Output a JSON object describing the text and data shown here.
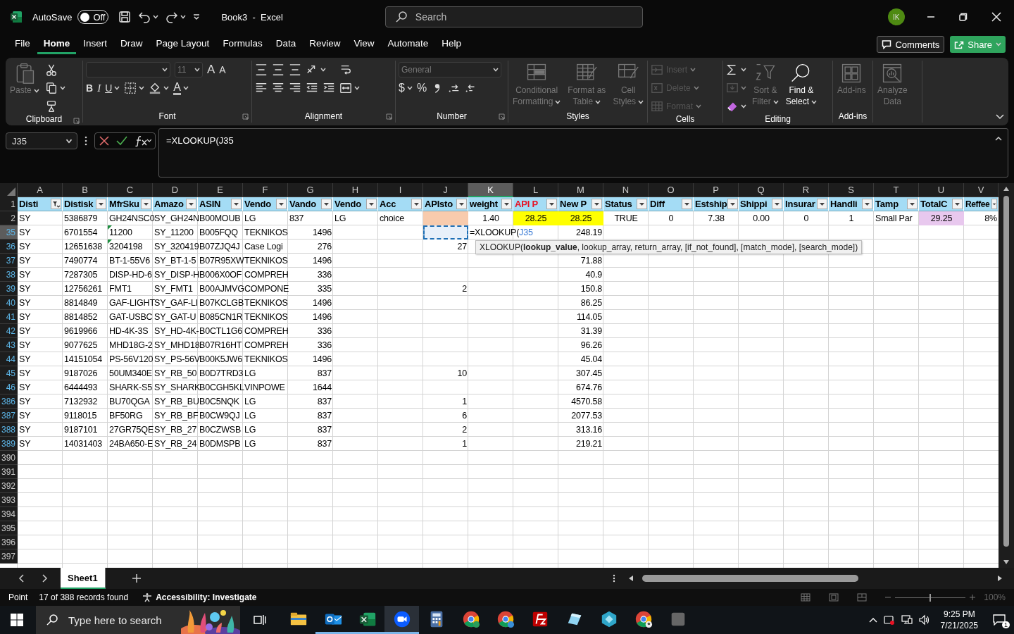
{
  "title_bar": {
    "autosave_label": "AutoSave",
    "autosave": {
      "on": false,
      "label": "Off"
    },
    "title": "Book3  -  Excel",
    "search_placeholder": "Search",
    "avatar": "IK"
  },
  "menu_tabs": [
    {
      "label": "File",
      "selected": false
    },
    {
      "label": "Home",
      "selected": true
    },
    {
      "label": "Insert",
      "selected": false
    },
    {
      "label": "Draw",
      "selected": false
    },
    {
      "label": "Page Layout",
      "selected": false
    },
    {
      "label": "Formulas",
      "selected": false
    },
    {
      "label": "Data",
      "selected": false
    },
    {
      "label": "Review",
      "selected": false
    },
    {
      "label": "View",
      "selected": false
    },
    {
      "label": "Automate",
      "selected": false
    },
    {
      "label": "Help",
      "selected": false
    }
  ],
  "comments_button": "Comments",
  "share_button": "Share",
  "ribbon": {
    "groups": [
      {
        "label": "Clipboard",
        "launcher": true,
        "sections": [
          {
            "kind": "large",
            "label": "Paste",
            "disabled": true,
            "menu": true
          },
          {
            "kind": "rows",
            "rows": [
              [
                {
                  "kind": "icon",
                  "disabled": false
                }
              ],
              [
                {
                  "kind": "icon",
                  "disabled": false,
                  "menu": true
                }
              ],
              [
                {
                  "kind": "icon",
                  "disabled": false
                }
              ]
            ]
          }
        ]
      },
      {
        "label": "Font",
        "launcher": true,
        "sections": [
          {
            "kind": "rows",
            "rows": [
              [
                {
                  "kind": "field",
                  "disabled": true,
                  "menu": true
                },
                {
                  "kind": "field",
                  "value": "11",
                  "disabled": true,
                  "menu": true
                },
                {
                  "kind": "glyph",
                  "text": "A",
                  "disabled": false
                },
                {
                  "kind": "glyph",
                  "text": "A",
                  "disabled": false
                }
              ],
              [
                {
                  "kind": "glyph",
                  "text": "B",
                  "disabled": false
                },
                {
                  "kind": "glyph",
                  "text": "I",
                  "disabled": false
                },
                {
                  "kind": "glyph",
                  "text": "U",
                  "disabled": false,
                  "menu": true
                },
                {
                  "kind": "icon",
                  "disabled": false,
                  "menu": true
                },
                {
                  "kind": "icon",
                  "disabled": false,
                  "menu": true
                },
                {
                  "kind": "glyph",
                  "text": "A",
                  "disabled": false,
                  "menu": true
                }
              ]
            ]
          }
        ]
      },
      {
        "label": "Alignment",
        "launcher": true,
        "sections": [
          {
            "kind": "rows",
            "rows": [
              [
                {
                  "kind": "icon",
                  "disabled": false
                },
                {
                  "kind": "icon",
                  "disabled": false
                },
                {
                  "kind": "icon",
                  "disabled": false
                },
                {
                  "kind": "icon",
                  "disabled": false,
                  "menu": true
                }
              ],
              [
                {
                  "kind": "icon",
                  "disabled": false
                },
                {
                  "kind": "icon",
                  "disabled": false
                },
                {
                  "kind": "icon",
                  "disabled": false
                },
                {
                  "kind": "icon",
                  "disabled": false
                },
                {
                  "kind": "icon",
                  "disabled": false
                }
              ]
            ]
          },
          {
            "kind": "rows",
            "rows": [
              [
                {
                  "kind": "icon",
                  "disabled": false
                }
              ],
              [
                {
                  "kind": "icon",
                  "disabled": false,
                  "menu": true
                }
              ]
            ]
          }
        ]
      },
      {
        "label": "Number",
        "launcher": true,
        "sections": [
          {
            "kind": "rows",
            "rows": [
              [
                {
                  "kind": "field",
                  "value": "General",
                  "disabled": true,
                  "menu": true
                }
              ],
              [
                {
                  "kind": "glyph",
                  "text": "$",
                  "disabled": false,
                  "menu": true
                },
                {
                  "kind": "glyph",
                  "text": "%",
                  "disabled": false
                },
                {
                  "kind": "icon",
                  "disabled": false
                },
                {
                  "kind": "icon",
                  "disabled": false
                },
                {
                  "kind": "icon",
                  "disabled": false
                }
              ]
            ]
          }
        ]
      },
      {
        "label": "Styles",
        "sections": [
          {
            "kind": "large",
            "label": "Conditional\nFormatting",
            "disabled": true,
            "menu": true
          },
          {
            "kind": "large",
            "label": "Format as\nTable",
            "disabled": true,
            "menu": true
          },
          {
            "kind": "large",
            "label": "Cell\nStyles",
            "disabled": true,
            "menu": true
          }
        ]
      },
      {
        "label": "Cells",
        "sections": [
          {
            "kind": "rows",
            "rows": [
              [
                {
                  "kind": "labeled",
                  "label": "Insert",
                  "disabled": true,
                  "menu": true
                }
              ],
              [
                {
                  "kind": "labeled",
                  "label": "Delete",
                  "disabled": true,
                  "menu": true
                }
              ],
              [
                {
                  "kind": "labeled",
                  "label": "Format",
                  "disabled": true,
                  "menu": true
                }
              ]
            ]
          }
        ]
      },
      {
        "label": "Editing",
        "sections": [
          {
            "kind": "rows",
            "rows": [
              [
                {
                  "kind": "icon",
                  "disabled": false,
                  "menu": true
                }
              ],
              [
                {
                  "kind": "icon",
                  "disabled": true,
                  "menu": true
                }
              ],
              [
                {
                  "kind": "icon",
                  "disabled": false,
                  "menu": true
                }
              ]
            ]
          },
          {
            "kind": "large",
            "label": "Sort &\nFilter",
            "disabled": true,
            "menu": true
          },
          {
            "kind": "large",
            "label": "Find &\nSelect",
            "disabled": false,
            "menu": true
          }
        ]
      },
      {
        "label": "Add-ins",
        "sections": [
          {
            "kind": "large",
            "label": "Add-ins",
            "disabled": true
          }
        ]
      },
      {
        "sections": [
          {
            "kind": "large",
            "label": "Analyze\nData",
            "disabled": true
          }
        ]
      }
    ]
  },
  "formula_bar": {
    "name_box": "J35",
    "formula": "=XLOOKUP(J35"
  },
  "sheet": {
    "columns": [
      {
        "letter": "A",
        "selected": false
      },
      {
        "letter": "B",
        "selected": false
      },
      {
        "letter": "C",
        "selected": false
      },
      {
        "letter": "D",
        "selected": false
      },
      {
        "letter": "E",
        "selected": false
      },
      {
        "letter": "F",
        "selected": false
      },
      {
        "letter": "G",
        "selected": false
      },
      {
        "letter": "H",
        "selected": false
      },
      {
        "letter": "I",
        "selected": false
      },
      {
        "letter": "J",
        "selected": false
      },
      {
        "letter": "K",
        "selected": true
      },
      {
        "letter": "L",
        "selected": false
      },
      {
        "letter": "M",
        "selected": false
      },
      {
        "letter": "N",
        "selected": false
      },
      {
        "letter": "O",
        "selected": false
      },
      {
        "letter": "P",
        "selected": false
      },
      {
        "letter": "Q",
        "selected": false
      },
      {
        "letter": "R",
        "selected": false
      },
      {
        "letter": "S",
        "selected": false
      },
      {
        "letter": "T",
        "selected": false
      },
      {
        "letter": "U",
        "selected": false
      },
      {
        "letter": "V",
        "selected": false
      }
    ],
    "rows": [
      {
        "number": "1",
        "kind": "header",
        "filtered": false,
        "selected": false,
        "cells": [
          {
            "text": "Disti",
            "filter_applied": true
          },
          {
            "text": "Distisk",
            "filter_applied": false
          },
          {
            "text": "MfrSku",
            "filter_applied": false
          },
          {
            "text": "Amazo",
            "filter_applied": false
          },
          {
            "text": "ASIN",
            "filter_applied": false
          },
          {
            "text": "Vendo",
            "filter_applied": false
          },
          {
            "text": "Vando",
            "filter_applied": false
          },
          {
            "text": "Vendo",
            "filter_applied": false
          },
          {
            "text": "Acc",
            "filter_applied": false
          },
          {
            "text": "APIsto",
            "filter_applied": false
          },
          {
            "text": "weight",
            "filter_applied": false
          },
          {
            "text": "API P",
            "color": "#e81123",
            "filter_applied": false
          },
          {
            "text": "New P",
            "filter_applied": false
          },
          {
            "text": "Status",
            "filter_applied": false
          },
          {
            "text": "Diff",
            "filter_applied": false
          },
          {
            "text": "Estship",
            "filter_applied": false
          },
          {
            "text": "Shippi",
            "filter_applied": false
          },
          {
            "text": "Insurar",
            "filter_applied": false
          },
          {
            "text": "Handli",
            "filter_applied": false
          },
          {
            "text": "Tamp",
            "filter_applied": false
          },
          {
            "text": "TotalC",
            "filter_applied": false
          },
          {
            "text": "Reffee",
            "filter_applied": false
          }
        ]
      },
      {
        "number": "2",
        "kind": "data",
        "filtered": false,
        "selected": false,
        "cells": [
          {
            "text": "SY"
          },
          {
            "text": "5386879"
          },
          {
            "text": "GH24NSC0"
          },
          {
            "text": "SY_GH24N"
          },
          {
            "text": "B00MOUB"
          },
          {
            "text": "LG"
          },
          {
            "text": "837"
          },
          {
            "text": "LG"
          },
          {
            "text": "choice"
          },
          {
            "color": "#f8cbad"
          },
          {
            "text": "1.40",
            "kind": "centered"
          },
          {
            "text": "28.25",
            "kind": "centered",
            "color": "#ffff00"
          },
          {
            "text": "28.25",
            "kind": "centered",
            "color": "#ffff00"
          },
          {
            "text": "TRUE",
            "kind": "centered"
          },
          {
            "text": "0",
            "kind": "centered"
          },
          {
            "text": "7.38",
            "kind": "centered"
          },
          {
            "text": "0.00",
            "kind": "centered"
          },
          {
            "text": "0",
            "kind": "centered"
          },
          {
            "text": "1",
            "kind": "centered"
          },
          {
            "text": "Small Par"
          },
          {
            "text": "29.25",
            "kind": "centered",
            "color": "#e8c8ee"
          },
          {
            "text": "8%",
            "kind": "numeric"
          }
        ]
      },
      {
        "number": "35",
        "kind": "data",
        "filtered": true,
        "selected": true,
        "cells": [
          {
            "text": "SY"
          },
          {
            "text": "6701554"
          },
          {
            "text": "11200",
            "error_mark": true
          },
          {
            "text": "SY_11200"
          },
          {
            "text": "B005FQQ"
          },
          {
            "text": "TEKNIKOS"
          },
          {
            "text": "1496",
            "kind": "numeric"
          },
          null,
          null,
          {
            "referenced": true
          },
          {
            "text": "=XLOOKUP(",
            "reference": "J35"
          },
          null,
          {
            "text": "248.19",
            "kind": "numeric"
          }
        ]
      },
      {
        "number": "36",
        "kind": "data",
        "filtered": true,
        "selected": false,
        "cells": [
          {
            "text": "SY"
          },
          {
            "text": "12651638"
          },
          {
            "text": "3204198",
            "error_mark": true
          },
          {
            "text": "SY_320419"
          },
          {
            "text": "B07ZJQ4J"
          },
          {
            "text": "Case Logi"
          },
          {
            "text": "276",
            "kind": "numeric"
          },
          null,
          null,
          {
            "text": "27",
            "kind": "numeric"
          }
        ]
      },
      {
        "number": "37",
        "kind": "data",
        "filtered": true,
        "selected": false,
        "cells": [
          {
            "text": "SY"
          },
          {
            "text": "7490774"
          },
          {
            "text": "BT-1-55V6"
          },
          {
            "text": "SY_BT-1-5"
          },
          {
            "text": "B07R95XW"
          },
          {
            "text": "TEKNIKOS"
          },
          {
            "text": "1496",
            "kind": "numeric"
          },
          null,
          null,
          null,
          null,
          null,
          {
            "text": "71.88",
            "kind": "numeric"
          }
        ]
      },
      {
        "number": "38",
        "kind": "data",
        "filtered": true,
        "selected": false,
        "cells": [
          {
            "text": "SY"
          },
          {
            "text": "7287305"
          },
          {
            "text": "DISP-HD-6"
          },
          {
            "text": "SY_DISP-H"
          },
          {
            "text": "B006X0OF"
          },
          {
            "text": "COMPREH"
          },
          {
            "text": "336",
            "kind": "numeric"
          },
          null,
          null,
          null,
          null,
          null,
          {
            "text": "40.9",
            "kind": "numeric"
          }
        ]
      },
      {
        "number": "39",
        "kind": "data",
        "filtered": true,
        "selected": false,
        "cells": [
          {
            "text": "SY"
          },
          {
            "text": "12756261"
          },
          {
            "text": "FMT1"
          },
          {
            "text": "SY_FMT1"
          },
          {
            "text": "B00AJMVG"
          },
          {
            "text": "COMPONE"
          },
          {
            "text": "335",
            "kind": "numeric"
          },
          null,
          null,
          {
            "text": "2",
            "kind": "numeric"
          },
          null,
          null,
          {
            "text": "150.8",
            "kind": "numeric"
          }
        ]
      },
      {
        "number": "40",
        "kind": "data",
        "filtered": true,
        "selected": false,
        "cells": [
          {
            "text": "SY"
          },
          {
            "text": "8814849"
          },
          {
            "text": "GAF-LIGHT"
          },
          {
            "text": "SY_GAF-LI"
          },
          {
            "text": "B07KCLGB"
          },
          {
            "text": "TEKNIKOS"
          },
          {
            "text": "1496",
            "kind": "numeric"
          },
          null,
          null,
          null,
          null,
          null,
          {
            "text": "86.25",
            "kind": "numeric"
          }
        ]
      },
      {
        "number": "41",
        "kind": "data",
        "filtered": true,
        "selected": false,
        "cells": [
          {
            "text": "SY"
          },
          {
            "text": "8814852"
          },
          {
            "text": "GAT-USBC"
          },
          {
            "text": "SY_GAT-U"
          },
          {
            "text": "B085CN1R"
          },
          {
            "text": "TEKNIKOS"
          },
          {
            "text": "1496",
            "kind": "numeric"
          },
          null,
          null,
          null,
          null,
          null,
          {
            "text": "114.05",
            "kind": "numeric"
          }
        ]
      },
      {
        "number": "42",
        "kind": "data",
        "filtered": true,
        "selected": false,
        "cells": [
          {
            "text": "SY"
          },
          {
            "text": "9619966"
          },
          {
            "text": "HD-4K-3S"
          },
          {
            "text": "SY_HD-4K-"
          },
          {
            "text": "B0CTL1G6"
          },
          {
            "text": "COMPREH"
          },
          {
            "text": "336",
            "kind": "numeric"
          },
          null,
          null,
          null,
          null,
          null,
          {
            "text": "31.39",
            "kind": "numeric"
          }
        ]
      },
      {
        "number": "43",
        "kind": "data",
        "filtered": true,
        "selected": false,
        "cells": [
          {
            "text": "SY"
          },
          {
            "text": "9077625"
          },
          {
            "text": "MHD18G-2"
          },
          {
            "text": "SY_MHD18"
          },
          {
            "text": "B07R16HT"
          },
          {
            "text": "COMPREH"
          },
          {
            "text": "336",
            "kind": "numeric"
          },
          null,
          null,
          null,
          null,
          null,
          {
            "text": "96.26",
            "kind": "numeric"
          }
        ]
      },
      {
        "number": "44",
        "kind": "data",
        "filtered": true,
        "selected": false,
        "cells": [
          {
            "text": "SY"
          },
          {
            "text": "14151054"
          },
          {
            "text": "PS-56V120"
          },
          {
            "text": "SY_PS-56V"
          },
          {
            "text": "B00K5JW6"
          },
          {
            "text": "TEKNIKOS"
          },
          {
            "text": "1496",
            "kind": "numeric"
          },
          null,
          null,
          null,
          null,
          null,
          {
            "text": "45.04",
            "kind": "numeric"
          }
        ]
      },
      {
        "number": "45",
        "kind": "data",
        "filtered": true,
        "selected": false,
        "cells": [
          {
            "text": "SY"
          },
          {
            "text": "9187026"
          },
          {
            "text": "50UM340E"
          },
          {
            "text": "SY_RB_50"
          },
          {
            "text": "B0D7TRD3"
          },
          {
            "text": "LG"
          },
          {
            "text": "837",
            "kind": "numeric"
          },
          null,
          null,
          {
            "text": "10",
            "kind": "numeric"
          },
          null,
          null,
          {
            "text": "307.45",
            "kind": "numeric"
          }
        ]
      },
      {
        "number": "46",
        "kind": "data",
        "filtered": true,
        "selected": false,
        "cells": [
          {
            "text": "SY"
          },
          {
            "text": "6444493"
          },
          {
            "text": "SHARK-S5"
          },
          {
            "text": "SY_SHARK"
          },
          {
            "text": "B0CGH5KL"
          },
          {
            "text": "VINPOWE"
          },
          {
            "text": "1644",
            "kind": "numeric"
          },
          null,
          null,
          null,
          null,
          null,
          {
            "text": "674.76",
            "kind": "numeric"
          }
        ]
      },
      {
        "number": "386",
        "kind": "data",
        "filtered": true,
        "selected": false,
        "cells": [
          {
            "text": "SY"
          },
          {
            "text": "7132932"
          },
          {
            "text": "BU70QGA"
          },
          {
            "text": "SY_RB_BU"
          },
          {
            "text": "B0C5NQK"
          },
          {
            "text": "LG"
          },
          {
            "text": "837",
            "kind": "numeric"
          },
          null,
          null,
          {
            "text": "1",
            "kind": "numeric"
          },
          null,
          null,
          {
            "text": "4570.58",
            "kind": "numeric"
          }
        ]
      },
      {
        "number": "387",
        "kind": "data",
        "filtered": true,
        "selected": false,
        "cells": [
          {
            "text": "SY"
          },
          {
            "text": "9118015"
          },
          {
            "text": "BF50RG"
          },
          {
            "text": "SY_RB_BF"
          },
          {
            "text": "B0CW9QJ"
          },
          {
            "text": "LG"
          },
          {
            "text": "837",
            "kind": "numeric"
          },
          null,
          null,
          {
            "text": "6",
            "kind": "numeric"
          },
          null,
          null,
          {
            "text": "2077.53",
            "kind": "numeric"
          }
        ]
      },
      {
        "number": "388",
        "kind": "data",
        "filtered": true,
        "selected": false,
        "cells": [
          {
            "text": "SY"
          },
          {
            "text": "9187101"
          },
          {
            "text": "27GR75QE"
          },
          {
            "text": "SY_RB_27"
          },
          {
            "text": "B0CZWSB"
          },
          {
            "text": "LG"
          },
          {
            "text": "837",
            "kind": "numeric"
          },
          null,
          null,
          {
            "text": "2",
            "kind": "numeric"
          },
          null,
          null,
          {
            "text": "313.16",
            "kind": "numeric"
          }
        ]
      },
      {
        "number": "389",
        "kind": "data",
        "filtered": true,
        "selected": false,
        "cells": [
          {
            "text": "SY"
          },
          {
            "text": "14031403"
          },
          {
            "text": "24BA650-E"
          },
          {
            "text": "SY_RB_24"
          },
          {
            "text": "B0DMSPB"
          },
          {
            "text": "LG"
          },
          {
            "text": "837",
            "kind": "numeric"
          },
          null,
          null,
          {
            "text": "1",
            "kind": "numeric"
          },
          null,
          null,
          {
            "text": "219.21",
            "kind": "numeric"
          }
        ]
      },
      {
        "number": "390",
        "kind": "data",
        "filtered": false,
        "selected": false
      },
      {
        "number": "391",
        "kind": "data",
        "filtered": false,
        "selected": false
      },
      {
        "number": "392",
        "kind": "data",
        "filtered": false,
        "selected": false
      },
      {
        "number": "393",
        "kind": "data",
        "filtered": false,
        "selected": false
      },
      {
        "number": "394",
        "kind": "data",
        "filtered": false,
        "selected": false
      },
      {
        "number": "395",
        "kind": "data",
        "filtered": false,
        "selected": false
      },
      {
        "number": "396",
        "kind": "data",
        "filtered": false,
        "selected": false
      },
      {
        "number": "397",
        "kind": "data",
        "filtered": false,
        "selected": false
      }
    ],
    "function_tip": "XLOOKUP(**lookup_value**, lookup_array, return_array, [if_not_found], [match_mode], [search_mode])"
  },
  "sheet_tabs": [
    {
      "label": "Sheet1",
      "selected": true
    }
  ],
  "status_bar": {
    "mode": "Point",
    "records": "17 of 388 records found",
    "accessibility": "Accessibility: Investigate",
    "zoom": {
      "level": 0.5,
      "label": "100%"
    }
  },
  "taskbar": {
    "search_placeholder": "Type here to search",
    "apps": [
      {
        "running": false,
        "selected": false
      },
      {
        "running": true,
        "selected": false
      },
      {
        "running": true,
        "selected": false
      },
      {
        "running": true,
        "selected": true
      },
      {
        "running": false,
        "selected": false
      },
      {
        "running": false,
        "selected": false
      },
      {
        "running": false,
        "selected": false
      },
      {
        "running": false,
        "selected": false
      },
      {
        "running": false,
        "selected": false
      },
      {
        "running": false,
        "selected": false
      },
      {
        "running": false,
        "selected": false
      },
      {
        "running": false,
        "selected": false
      }
    ],
    "time": "9:25 PM",
    "date": "7/21/2025",
    "notifications": "1"
  }
}
